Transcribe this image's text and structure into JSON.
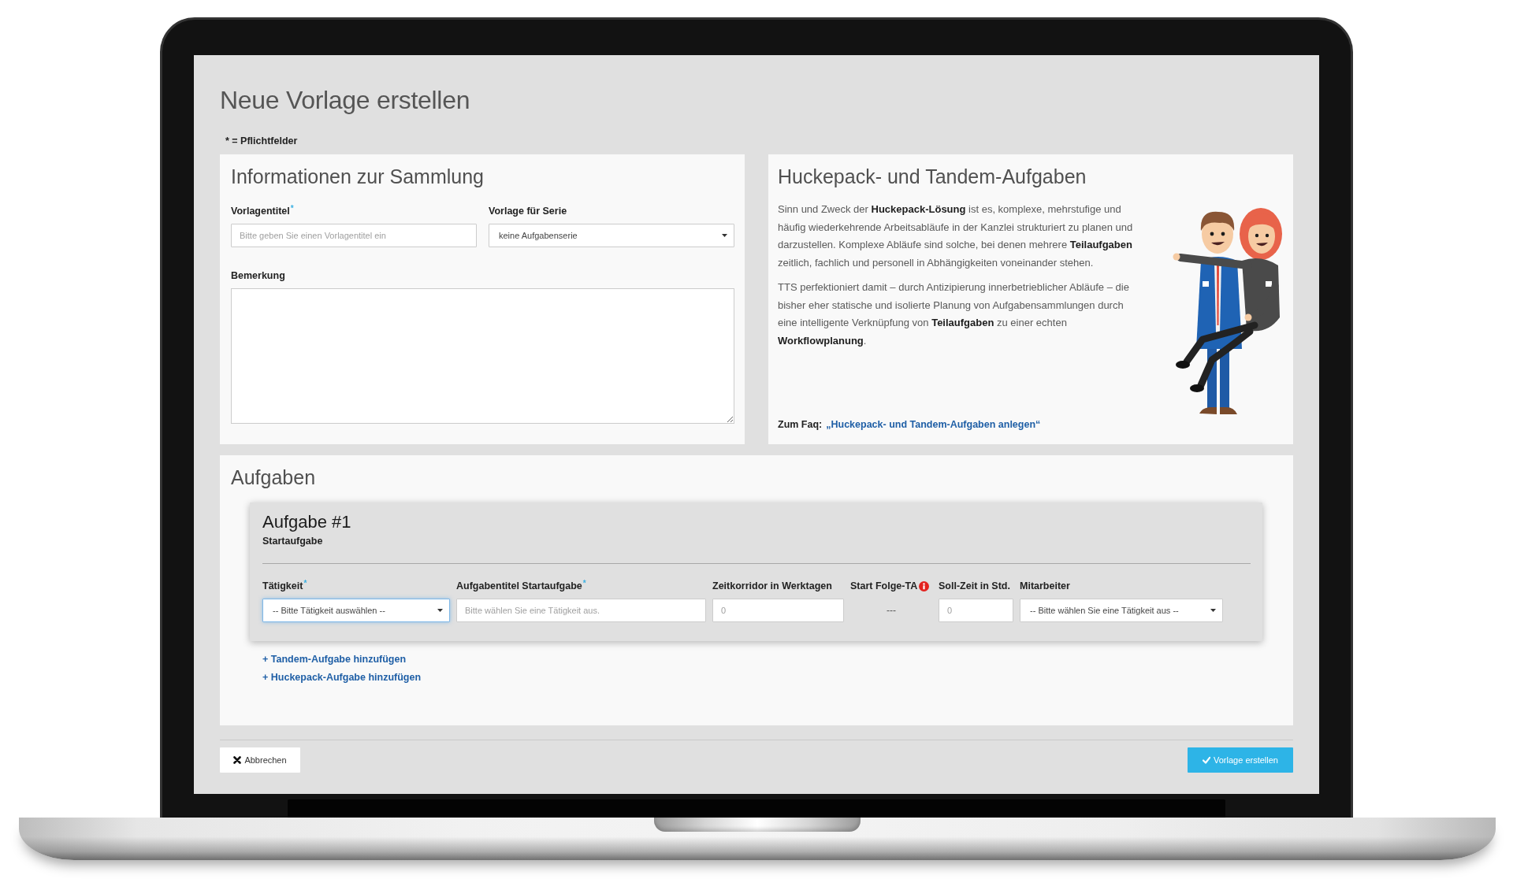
{
  "window": {
    "title": "Neue Vorlage erstellen",
    "required_note": "* = Pflichtfelder"
  },
  "collection": {
    "title": "Informationen zur Sammlung",
    "fields": [
      {
        "kind": "input",
        "label": "Vorlagentitel$^{*}$",
        "placeholder": "Bitte geben Sie einen Vorlagentitel ein"
      },
      {
        "kind": "select",
        "label": "Vorlage für Serie",
        "value": "keine Aufgabenserie"
      },
      {
        "kind": "textarea",
        "label": "Bemerkung"
      }
    ]
  },
  "info": {
    "title": "Huckepack- und Tandem-Aufgaben",
    "paragraphs": [
      "Sinn und Zweck der **Huckepack-Lösung** ist es, komplexe, mehrstufige und häufig wiederkehrende Arbeitsabläufe in der Kanzlei strukturiert zu planen und darzustellen. Komplexe Abläufe sind solche, bei denen mehrere **Teilaufgaben** zeitlich, fachlich und personell in Abhängigkeiten voneinander stehen.",
      "TTS perfektioniert damit – durch Antizipierung innerbetrieblicher Abläufe – die bisher eher statische und isolierte Planung von Aufgabensammlungen durch eine intelligente Verknüpfung von **Teilaufgaben** zu einer echten **Workflowplanung**."
    ],
    "faq": {
      "label": "Zum Faq:",
      "link": "„Huckepack- und Tandem-Aufgaben anlegen“"
    }
  },
  "tasks": {
    "title": "Aufgaben",
    "items": [
      {
        "title": "Aufgabe #1",
        "subtitle": "Startaufgabe",
        "fields": [
          {
            "kind": "select",
            "label": "Tätigkeit$^{*}$",
            "value": "-- Bitte Tätigkeit auswählen --",
            "focused": true,
            "info": false
          },
          {
            "kind": "input",
            "label": "Aufgabentitel Startaufgabe$^{*}$",
            "placeholder": "Bitte wählen Sie eine Tätigkeit aus.",
            "focused": false,
            "info": false
          },
          {
            "kind": "input",
            "label": "Zeitkorridor in Werktagen",
            "placeholder": "0",
            "focused": false,
            "info": false
          },
          {
            "kind": "static",
            "label": "Start Folge-TA",
            "value": "---",
            "focused": false,
            "info": true
          },
          {
            "kind": "input",
            "label": "Soll-Zeit in Std.",
            "placeholder": "0",
            "focused": false,
            "info": false
          },
          {
            "kind": "select",
            "label": "Mitarbeiter",
            "value": "-- Bitte wählen Sie eine Tätigkeit aus --",
            "focused": false,
            "info": false
          }
        ]
      }
    ],
    "links": [
      "+ Tandem-Aufgabe hinzufügen",
      "+ Huckepack-Aufgabe hinzufügen"
    ]
  },
  "buttons": [
    {
      "kind": "cancel",
      "label": "Abbrechen"
    },
    {
      "kind": "submit",
      "label": "Vorlage erstellen"
    }
  ]
}
